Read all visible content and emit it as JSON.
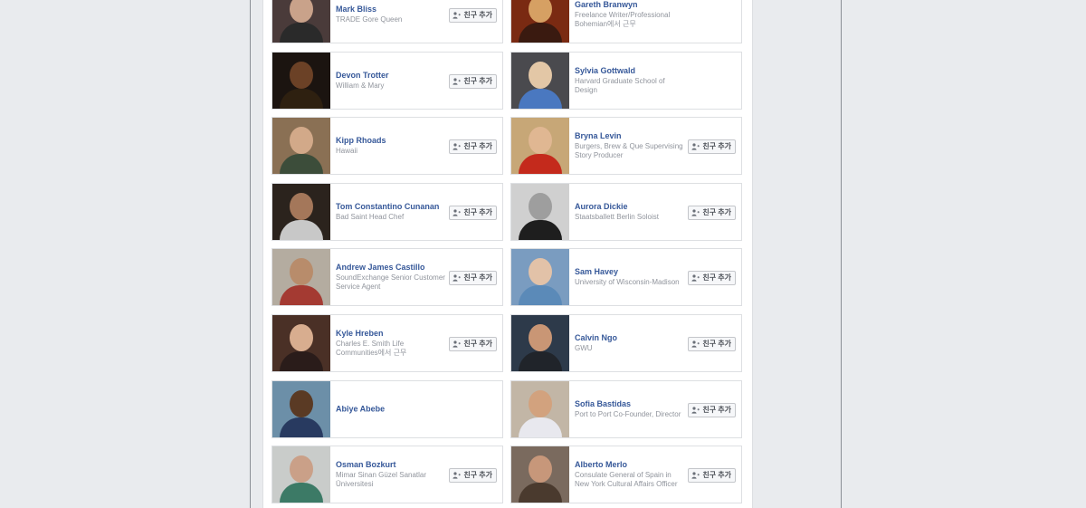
{
  "add_friend_label": "친구 추가",
  "colors": {
    "name_link": "#365899",
    "sub_text": "#90949c",
    "page_bg": "#e9ebee"
  },
  "friends": [
    {
      "name": "Mark Bliss",
      "sub": "TRADE Gore Queen",
      "button": true,
      "photo": {
        "bg": "#4a3b3a",
        "skin": "#c9a28a",
        "shirt": "#2a2a2a"
      }
    },
    {
      "name": "Gareth Branwyn",
      "sub": "Freelance Writer/Professional Bohemian에서 근무",
      "button": false,
      "photo": {
        "bg": "#7a2a12",
        "skin": "#d6a063",
        "shirt": "#3a1a10"
      }
    },
    {
      "name": "Devon Trotter",
      "sub": "William & Mary",
      "button": true,
      "photo": {
        "bg": "#1b1410",
        "skin": "#6b4126",
        "shirt": "#2e2010"
      }
    },
    {
      "name": "Sylvia Gottwald",
      "sub": "Harvard Graduate School of Design",
      "button": false,
      "photo": {
        "bg": "#4a4a4e",
        "skin": "#e3c7a6",
        "shirt": "#4a78c0"
      }
    },
    {
      "name": "Kipp Rhoads",
      "sub": "Hawaii",
      "button": true,
      "photo": {
        "bg": "#8a7054",
        "skin": "#d2a989",
        "shirt": "#3c4d3a"
      }
    },
    {
      "name": "Bryna Levin",
      "sub": "Burgers, Brew & Que Supervising Story Producer",
      "button": true,
      "photo": {
        "bg": "#c7a777",
        "skin": "#e0b792",
        "shirt": "#c42a1c"
      }
    },
    {
      "name": "Tom Constantino Cunanan",
      "sub": "Bad Saint Head Chef",
      "button": true,
      "photo": {
        "bg": "#2b231d",
        "skin": "#a4775a",
        "shirt": "#c8c8c8"
      }
    },
    {
      "name": "Aurora Dickie",
      "sub": "Staatsballett Berlin Soloist",
      "button": true,
      "photo": {
        "bg": "#d0d0d0",
        "skin": "#9e9e9e",
        "shirt": "#1e1e1e"
      }
    },
    {
      "name": "Andrew James Castillo",
      "sub": "SoundExchange Senior Customer Service Agent",
      "button": true,
      "photo": {
        "bg": "#b4aca0",
        "skin": "#b88c6b",
        "shirt": "#a43a32"
      }
    },
    {
      "name": "Sam Havey",
      "sub": "University of Wisconsin-Madison",
      "button": true,
      "photo": {
        "bg": "#7a9cc0",
        "skin": "#e2c2a8",
        "shirt": "#5b8ab8"
      }
    },
    {
      "name": "Kyle Hreben",
      "sub": "Charles E. Smith Life Communities에서 근무",
      "button": true,
      "photo": {
        "bg": "#4a3026",
        "skin": "#d8ad8f",
        "shirt": "#2a1c1a"
      }
    },
    {
      "name": "Calvin Ngo",
      "sub": "GWU",
      "button": true,
      "photo": {
        "bg": "#2d3a4a",
        "skin": "#c99675",
        "shirt": "#20242a"
      }
    },
    {
      "name": "Abiye Abebe",
      "sub": "",
      "button": false,
      "photo": {
        "bg": "#6c8fa8",
        "skin": "#5a3a24",
        "shirt": "#283a60"
      }
    },
    {
      "name": "Sofia Bastidas",
      "sub": "Port to Port Co-Founder, Director",
      "button": true,
      "photo": {
        "bg": "#c2b6a6",
        "skin": "#d2a27e",
        "shirt": "#e8e8ee"
      }
    },
    {
      "name": "Osman Bozkurt",
      "sub": "Mimar Sinan Güzel Sanatlar Üniversitesi",
      "button": true,
      "photo": {
        "bg": "#c9ccca",
        "skin": "#caa088",
        "shirt": "#3c7a66"
      }
    },
    {
      "name": "Alberto Merlo",
      "sub": "Consulate General of Spain in New York Cultural Affairs Officer",
      "button": true,
      "photo": {
        "bg": "#7a6a5e",
        "skin": "#c7977a",
        "shirt": "#4a3a2e"
      }
    }
  ]
}
